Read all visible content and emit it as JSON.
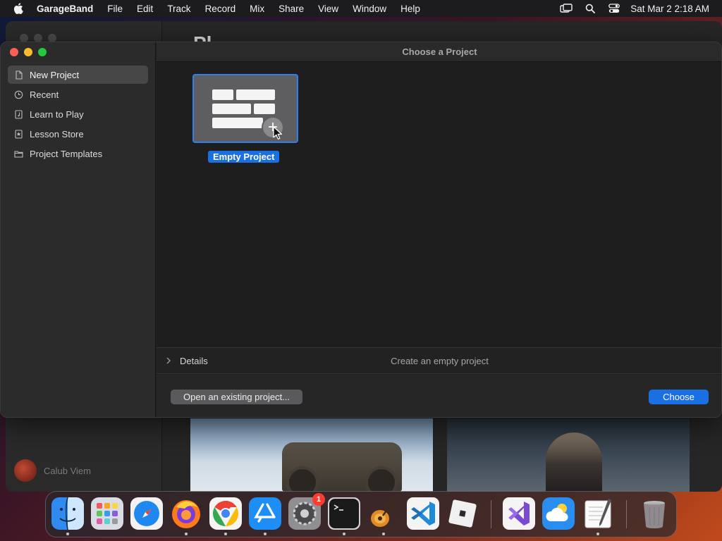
{
  "menubar": {
    "app_name": "GarageBand",
    "items": [
      "File",
      "Edit",
      "Track",
      "Record",
      "Mix",
      "Share",
      "View",
      "Window",
      "Help"
    ],
    "clock": "Sat Mar 2  2:18 AM"
  },
  "background_window": {
    "title_fragment": "Pl",
    "user_name": "Calub Viem"
  },
  "dialog": {
    "title": "Choose a Project",
    "sidebar": {
      "items": [
        {
          "label": "New Project",
          "icon": "document-icon",
          "active": true
        },
        {
          "label": "Recent",
          "icon": "clock-icon",
          "active": false
        },
        {
          "label": "Learn to Play",
          "icon": "music-book-icon",
          "active": false
        },
        {
          "label": "Lesson Store",
          "icon": "star-book-icon",
          "active": false
        },
        {
          "label": "Project Templates",
          "icon": "folder-icon",
          "active": false
        }
      ]
    },
    "project": {
      "label": "Empty Project",
      "selected": true
    },
    "details": {
      "label": "Details",
      "description": "Create an empty project"
    },
    "buttons": {
      "open_existing": "Open an existing project...",
      "choose": "Choose"
    }
  },
  "dock": {
    "apps": [
      {
        "name": "Finder",
        "icon": "finder-icon",
        "running": true
      },
      {
        "name": "Launchpad",
        "icon": "launchpad-icon",
        "running": false
      },
      {
        "name": "Safari",
        "icon": "safari-icon",
        "running": false
      },
      {
        "name": "Firefox",
        "icon": "firefox-icon",
        "running": true
      },
      {
        "name": "Chrome",
        "icon": "chrome-icon",
        "running": true
      },
      {
        "name": "App Store",
        "icon": "app-store-icon",
        "running": true
      },
      {
        "name": "System Settings",
        "icon": "system-settings-icon",
        "running": false,
        "badge": "1"
      },
      {
        "name": "Terminal",
        "icon": "terminal-icon",
        "running": true
      },
      {
        "name": "GarageBand",
        "icon": "garageband-icon",
        "running": true
      },
      {
        "name": "Visual Studio Code",
        "icon": "vscode-icon",
        "running": false
      },
      {
        "name": "Roblox",
        "icon": "roblox-icon",
        "running": false
      },
      {
        "name": "Visual Studio",
        "icon": "visual-studio-icon",
        "running": false
      },
      {
        "name": "Weather",
        "icon": "weather-icon",
        "running": false
      },
      {
        "name": "TextEdit",
        "icon": "textedit-icon",
        "running": true
      },
      {
        "name": "Trash",
        "icon": "trash-icon",
        "running": false
      }
    ]
  },
  "colors": {
    "accent": "#1a6fe3",
    "traffic_close": "#ff5f57",
    "traffic_minimize": "#febc2e",
    "traffic_maximize": "#28c840",
    "badge": "#ff3b30"
  }
}
